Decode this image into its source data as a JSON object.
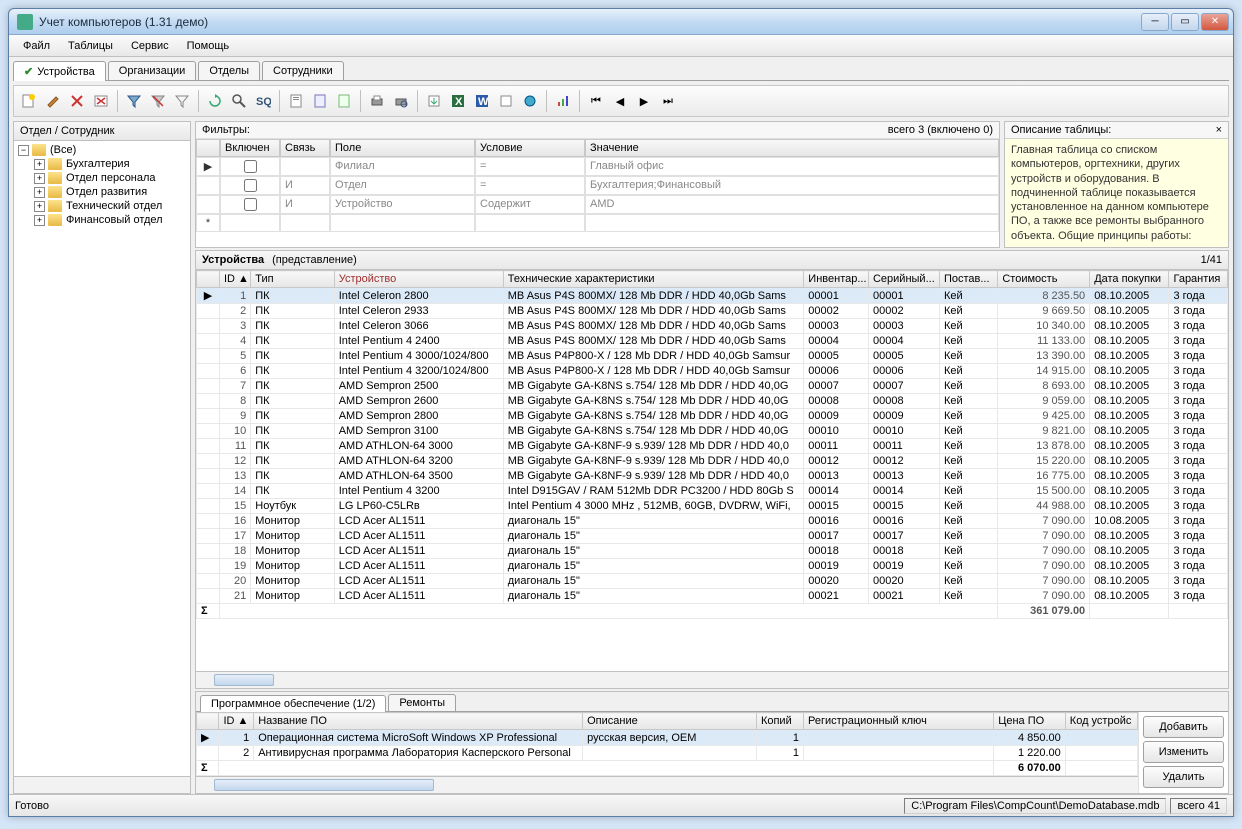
{
  "title": "Учет компьютеров (1.31 демо)",
  "menu": [
    "Файл",
    "Таблицы",
    "Сервис",
    "Помощь"
  ],
  "tabs": [
    {
      "label": "Устройства",
      "active": true
    },
    {
      "label": "Организации"
    },
    {
      "label": "Отделы"
    },
    {
      "label": "Сотрудники"
    }
  ],
  "leftPanel": {
    "header": "Отдел / Сотрудник",
    "root": "(Все)",
    "items": [
      "Бухгалтерия",
      "Отдел персонала",
      "Отдел развития",
      "Технический отдел",
      "Финансовый отдел"
    ]
  },
  "filters": {
    "header": "Фильтры:",
    "counter": "всего 3 (включено 0)",
    "cols": [
      "",
      "Включен",
      "Связь",
      "Поле",
      "Условие",
      "Значение"
    ],
    "rows": [
      {
        "mark": "▶",
        "incl": false,
        "rel": "",
        "field": "Филиал",
        "cond": "=",
        "val": "Главный офис"
      },
      {
        "mark": "",
        "incl": false,
        "rel": "И",
        "field": "Отдел",
        "cond": "=",
        "val": "Бухгалтерия;Финансовый"
      },
      {
        "mark": "",
        "incl": false,
        "rel": "И",
        "field": "Устройство",
        "cond": "Содержит",
        "val": "AMD"
      },
      {
        "mark": "*",
        "incl": null,
        "rel": "",
        "field": "",
        "cond": "",
        "val": ""
      }
    ]
  },
  "desc": {
    "header": "Описание таблицы:",
    "text": "Главная таблица со списком компьютеров, оргтехники, других устройств и оборудования. В подчиненной таблице показывается установленное на данном компьютере ПО, а также все ремонты выбранного объекта. Общие принципы работы:"
  },
  "devices": {
    "title": "Устройства",
    "view": "(представление)",
    "counter": "1/41",
    "cols": [
      "",
      "ID ▲",
      "Тип",
      "Устройство",
      "Технические характеристики",
      "Инвентар...",
      "Серийный...",
      "Постав...",
      "Стоимость",
      "Дата покупки",
      "Гарантия"
    ],
    "rows": [
      {
        "id": 1,
        "type": "ПК",
        "dev": "Intel Celeron 2800",
        "tech": "MB Asus P4S 800MX/ 128 Mb DDR / HDD 40,0Gb Sams",
        "inv": "00001",
        "ser": "00001",
        "sup": "Кей",
        "cost": "8 235.50",
        "date": "08.10.2005",
        "war": "3 года",
        "sel": true
      },
      {
        "id": 2,
        "type": "ПК",
        "dev": "Intel Celeron 2933",
        "tech": "MB Asus P4S 800MX/ 128 Mb DDR / HDD 40,0Gb Sams",
        "inv": "00002",
        "ser": "00002",
        "sup": "Кей",
        "cost": "9 669.50",
        "date": "08.10.2005",
        "war": "3 года"
      },
      {
        "id": 3,
        "type": "ПК",
        "dev": "Intel Celeron 3066",
        "tech": "MB Asus P4S 800MX/ 128 Mb DDR / HDD 40,0Gb Sams",
        "inv": "00003",
        "ser": "00003",
        "sup": "Кей",
        "cost": "10 340.00",
        "date": "08.10.2005",
        "war": "3 года"
      },
      {
        "id": 4,
        "type": "ПК",
        "dev": "Intel Pentium 4 2400",
        "tech": "MB Asus P4S 800MX/ 128 Mb DDR / HDD 40,0Gb Sams",
        "inv": "00004",
        "ser": "00004",
        "sup": "Кей",
        "cost": "11 133.00",
        "date": "08.10.2005",
        "war": "3 года"
      },
      {
        "id": 5,
        "type": "ПК",
        "dev": "Intel Pentium 4 3000/1024/800",
        "tech": "MB Asus P4P800-X / 128 Mb DDR / HDD 40,0Gb Samsur",
        "inv": "00005",
        "ser": "00005",
        "sup": "Кей",
        "cost": "13 390.00",
        "date": "08.10.2005",
        "war": "3 года"
      },
      {
        "id": 6,
        "type": "ПК",
        "dev": "Intel Pentium 4 3200/1024/800",
        "tech": "MB Asus P4P800-X / 128 Mb DDR / HDD 40,0Gb Samsur",
        "inv": "00006",
        "ser": "00006",
        "sup": "Кей",
        "cost": "14 915.00",
        "date": "08.10.2005",
        "war": "3 года"
      },
      {
        "id": 7,
        "type": "ПК",
        "dev": "AMD Sempron 2500",
        "tech": "MB Gigabyte GA-K8NS s.754/ 128 Mb DDR / HDD 40,0G",
        "inv": "00007",
        "ser": "00007",
        "sup": "Кей",
        "cost": "8 693.00",
        "date": "08.10.2005",
        "war": "3 года"
      },
      {
        "id": 8,
        "type": "ПК",
        "dev": "AMD Sempron 2600",
        "tech": "MB Gigabyte GA-K8NS s.754/ 128 Mb DDR / HDD 40,0G",
        "inv": "00008",
        "ser": "00008",
        "sup": "Кей",
        "cost": "9 059.00",
        "date": "08.10.2005",
        "war": "3 года"
      },
      {
        "id": 9,
        "type": "ПК",
        "dev": "AMD Sempron 2800",
        "tech": "MB Gigabyte GA-K8NS s.754/ 128 Mb DDR / HDD 40,0G",
        "inv": "00009",
        "ser": "00009",
        "sup": "Кей",
        "cost": "9 425.00",
        "date": "08.10.2005",
        "war": "3 года"
      },
      {
        "id": 10,
        "type": "ПК",
        "dev": "AMD Sempron 3100",
        "tech": "MB Gigabyte GA-K8NS s.754/ 128 Mb DDR / HDD 40,0G",
        "inv": "00010",
        "ser": "00010",
        "sup": "Кей",
        "cost": "9 821.00",
        "date": "08.10.2005",
        "war": "3 года"
      },
      {
        "id": 11,
        "type": "ПК",
        "dev": "AMD ATHLON-64 3000",
        "tech": "MB Gigabyte GA-K8NF-9 s.939/ 128 Mb DDR / HDD 40,0",
        "inv": "00011",
        "ser": "00011",
        "sup": "Кей",
        "cost": "13 878.00",
        "date": "08.10.2005",
        "war": "3 года"
      },
      {
        "id": 12,
        "type": "ПК",
        "dev": "AMD ATHLON-64 3200",
        "tech": "MB Gigabyte GA-K8NF-9 s.939/ 128 Mb DDR / HDD 40,0",
        "inv": "00012",
        "ser": "00012",
        "sup": "Кей",
        "cost": "15 220.00",
        "date": "08.10.2005",
        "war": "3 года"
      },
      {
        "id": 13,
        "type": "ПК",
        "dev": "AMD ATHLON-64 3500",
        "tech": "MB Gigabyte GA-K8NF-9 s.939/ 128 Mb DDR / HDD 40,0",
        "inv": "00013",
        "ser": "00013",
        "sup": "Кей",
        "cost": "16 775.00",
        "date": "08.10.2005",
        "war": "3 года"
      },
      {
        "id": 14,
        "type": "ПК",
        "dev": "Intel Pentium 4 3200",
        "tech": "Intel D915GAV / RAM 512Mb DDR PC3200 / HDD 80Gb S",
        "inv": "00014",
        "ser": "00014",
        "sup": "Кей",
        "cost": "15 500.00",
        "date": "08.10.2005",
        "war": "3 года"
      },
      {
        "id": 15,
        "type": "Ноутбук",
        "dev": "LG LP60-C5LRв",
        "tech": "Intel Pentium 4 3000 MHz , 512MB, 60GB, DVDRW, WiFi,",
        "inv": "00015",
        "ser": "00015",
        "sup": "Кей",
        "cost": "44 988.00",
        "date": "08.10.2005",
        "war": "3 года"
      },
      {
        "id": 16,
        "type": "Монитор",
        "dev": "LCD Acer AL1511",
        "tech": "диагональ 15\"",
        "inv": "00016",
        "ser": "00016",
        "sup": "Кей",
        "cost": "7 090.00",
        "date": "10.08.2005",
        "war": "3 года"
      },
      {
        "id": 17,
        "type": "Монитор",
        "dev": "LCD Acer AL1511",
        "tech": "диагональ 15\"",
        "inv": "00017",
        "ser": "00017",
        "sup": "Кей",
        "cost": "7 090.00",
        "date": "08.10.2005",
        "war": "3 года"
      },
      {
        "id": 18,
        "type": "Монитор",
        "dev": "LCD Acer AL1511",
        "tech": "диагональ 15\"",
        "inv": "00018",
        "ser": "00018",
        "sup": "Кей",
        "cost": "7 090.00",
        "date": "08.10.2005",
        "war": "3 года"
      },
      {
        "id": 19,
        "type": "Монитор",
        "dev": "LCD Acer AL1511",
        "tech": "диагональ 15\"",
        "inv": "00019",
        "ser": "00019",
        "sup": "Кей",
        "cost": "7 090.00",
        "date": "08.10.2005",
        "war": "3 года"
      },
      {
        "id": 20,
        "type": "Монитор",
        "dev": "LCD Acer AL1511",
        "tech": "диагональ 15\"",
        "inv": "00020",
        "ser": "00020",
        "sup": "Кей",
        "cost": "7 090.00",
        "date": "08.10.2005",
        "war": "3 года"
      },
      {
        "id": 21,
        "type": "Монитор",
        "dev": "LCD Acer AL1511",
        "tech": "диагональ 15\"",
        "inv": "00021",
        "ser": "00021",
        "sup": "Кей",
        "cost": "7 090.00",
        "date": "08.10.2005",
        "war": "3 года"
      }
    ],
    "sum_label": "Σ",
    "sum": "361 079.00"
  },
  "software": {
    "tabs": [
      {
        "label": "Программное обеспечение (1/2)",
        "active": true
      },
      {
        "label": "Ремонты"
      }
    ],
    "cols": [
      "",
      "ID ▲",
      "Название ПО",
      "Описание",
      "Копий",
      "Регистрационный ключ",
      "Цена ПО",
      "Код устройс"
    ],
    "rows": [
      {
        "id": 1,
        "name": "Операционная система MicroSoft Windows XP Professional",
        "desc": "русская версия, OEM",
        "copies": 1,
        "key": "",
        "price": "4 850.00",
        "dev": "",
        "sel": true
      },
      {
        "id": 2,
        "name": "Антивирусная программа Лаборатория Касперского Personal",
        "desc": "",
        "copies": 1,
        "key": "",
        "price": "1 220.00",
        "dev": ""
      }
    ],
    "sum_label": "Σ",
    "sum": "6 070.00",
    "btns": [
      "Добавить",
      "Изменить",
      "Удалить"
    ]
  },
  "status": {
    "left": "Готово",
    "path": "C:\\Program Files\\CompCount\\DemoDatabase.mdb",
    "count": "всего 41"
  }
}
